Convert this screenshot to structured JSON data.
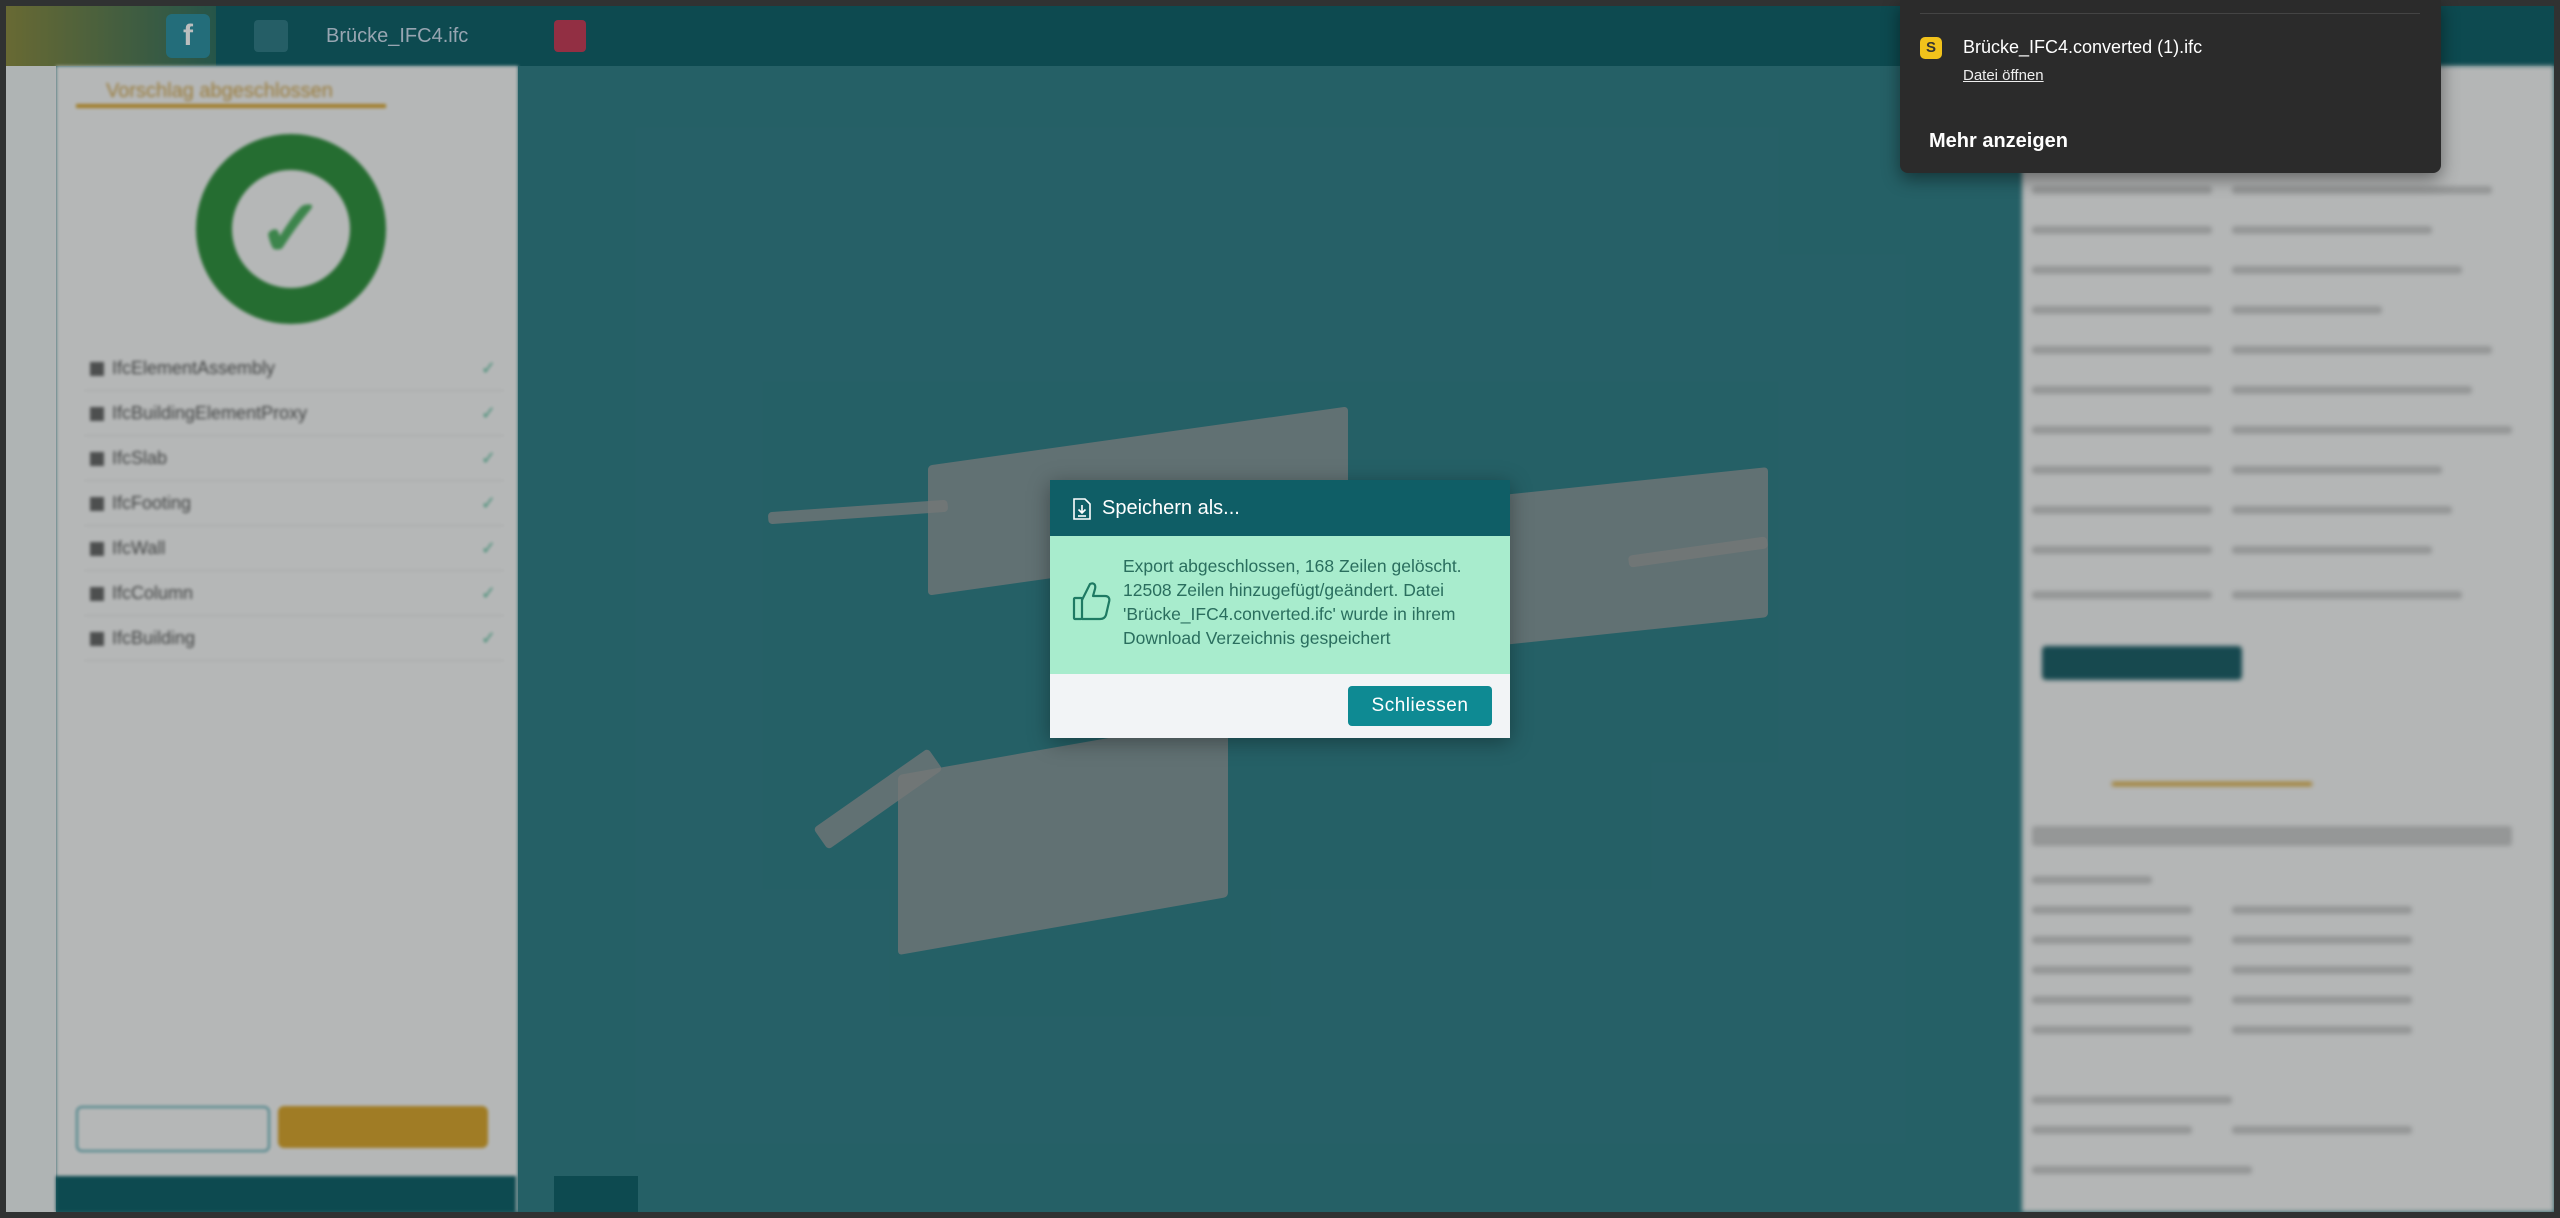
{
  "topbar": {
    "file_tab": "Brücke_IFC4.ifc",
    "logo_letter": "f"
  },
  "left_panel": {
    "tab_label": "Vorschlag abgeschlossen",
    "ifc_items": [
      "IfcElementAssembly",
      "IfcBuildingElementProxy",
      "IfcSlab",
      "IfcFooting",
      "IfcWall",
      "IfcColumn",
      "IfcBuilding"
    ]
  },
  "dialog": {
    "title": "Speichern als...",
    "message": "Export abgeschlossen, 168 Zeilen gelöscht. 12508 Zeilen hinzugefügt/geändert. Datei 'Brücke_IFC4.converted.ifc' wurde in ihrem Download Verzeichnis gespeichert",
    "close_button": "Schliessen"
  },
  "download_popup": {
    "file_name": "Brücke_IFC4.converted (1).ifc",
    "open_link": "Datei öffnen",
    "more_label": "Mehr anzeigen",
    "file_icon_glyph": "S"
  },
  "colors": {
    "header_teal": "#0f5e66",
    "success_bg": "#a8eccd",
    "button_teal": "#0e8a93",
    "viewport_bg": "#2f7d86",
    "accent_gold": "#d9a42b"
  }
}
